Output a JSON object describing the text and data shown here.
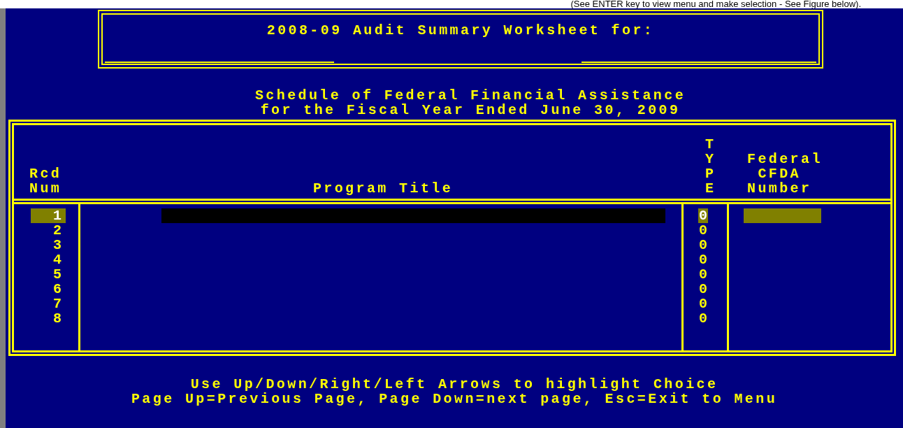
{
  "note": "(See ENTER key to view menu and make selection - See Figure below).",
  "header": {
    "title": "2008-09 Audit Summary Worksheet for:"
  },
  "subtitle": [
    "Schedule of Federal Financial Assistance",
    "for the Fiscal Year Ended June 30, 2009"
  ],
  "table": {
    "columns": [
      "Rcd\nNum",
      "Program Title",
      "TYPE",
      "Federal\n CFDA\nNumber"
    ],
    "rows": [
      {
        "rcd": "1",
        "type": "0",
        "selected": true
      },
      {
        "rcd": "2",
        "type": "0",
        "selected": false
      },
      {
        "rcd": "3",
        "type": "0",
        "selected": false
      },
      {
        "rcd": "4",
        "type": "0",
        "selected": false
      },
      {
        "rcd": "5",
        "type": "0",
        "selected": false
      },
      {
        "rcd": "6",
        "type": "0",
        "selected": false
      },
      {
        "rcd": "7",
        "type": "0",
        "selected": false
      },
      {
        "rcd": "8",
        "type": "0",
        "selected": false
      }
    ]
  },
  "instructions": [
    "Use Up/Down/Right/Left Arrows to highlight Choice",
    "Page Up=Previous Page, Page Down=next page, Esc=Exit to Menu"
  ]
}
